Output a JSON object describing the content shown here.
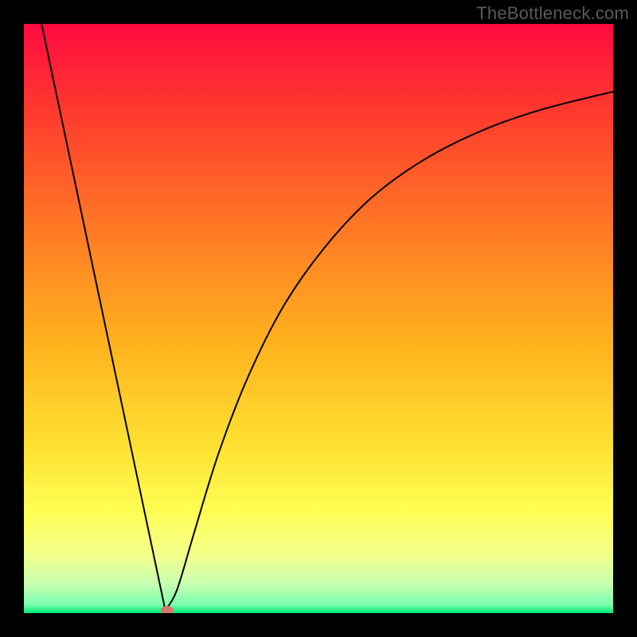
{
  "watermark": "TheBottleneck.com",
  "chart_data": {
    "type": "line",
    "title": "",
    "xlabel": "",
    "ylabel": "",
    "xlim": [
      0,
      100
    ],
    "ylim": [
      0,
      100
    ],
    "grid": false,
    "legend": false,
    "annotations": [],
    "background_gradient_stops": [
      {
        "offset": 0.0,
        "color": "#ff0a3f"
      },
      {
        "offset": 0.15,
        "color": "#ff3a2e"
      },
      {
        "offset": 0.35,
        "color": "#ff7a25"
      },
      {
        "offset": 0.55,
        "color": "#ffb41e"
      },
      {
        "offset": 0.72,
        "color": "#ffe233"
      },
      {
        "offset": 0.83,
        "color": "#ffff55"
      },
      {
        "offset": 0.9,
        "color": "#f4ff8a"
      },
      {
        "offset": 0.95,
        "color": "#c8ffb0"
      },
      {
        "offset": 0.985,
        "color": "#7dffb0"
      },
      {
        "offset": 1.0,
        "color": "#00e676"
      }
    ],
    "series": [
      {
        "name": "main-curve",
        "color": "#000000",
        "segments": [
          {
            "type": "line",
            "points": [
              {
                "x": 3.0,
                "y": 100.0
              },
              {
                "x": 24.0,
                "y": 0.5
              }
            ]
          },
          {
            "type": "curve",
            "points": [
              {
                "x": 24.0,
                "y": 0.5
              },
              {
                "x": 26.0,
                "y": 4.0
              },
              {
                "x": 29.0,
                "y": 14.0
              },
              {
                "x": 33.0,
                "y": 27.0
              },
              {
                "x": 38.0,
                "y": 40.0
              },
              {
                "x": 44.0,
                "y": 52.0
              },
              {
                "x": 51.0,
                "y": 62.0
              },
              {
                "x": 59.0,
                "y": 70.5
              },
              {
                "x": 68.0,
                "y": 77.0
              },
              {
                "x": 78.0,
                "y": 82.0
              },
              {
                "x": 88.0,
                "y": 85.5
              },
              {
                "x": 100.0,
                "y": 88.5
              }
            ]
          }
        ]
      }
    ],
    "marker": {
      "x": 24.3,
      "y": 0.5,
      "color": "#d47a6a",
      "rx": 1.1,
      "ry": 0.7
    }
  }
}
